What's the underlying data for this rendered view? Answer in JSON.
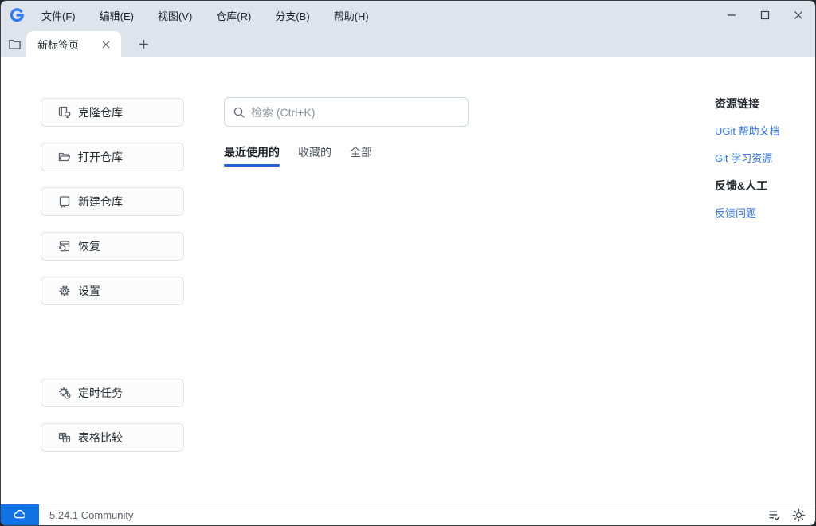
{
  "window": {
    "menu": [
      "文件(F)",
      "编辑(E)",
      "视图(V)",
      "仓库(R)",
      "分支(B)",
      "帮助(H)"
    ]
  },
  "tabbar": {
    "tab_label": "新标签页"
  },
  "sidebar": {
    "buttons": [
      {
        "label": "克隆仓库",
        "icon": "repo-clone-icon"
      },
      {
        "label": "打开仓库",
        "icon": "folder-open-icon"
      },
      {
        "label": "新建仓库",
        "icon": "repo-new-icon"
      },
      {
        "label": "恢复",
        "icon": "restore-icon"
      },
      {
        "label": "设置",
        "icon": "gear-icon"
      }
    ],
    "tools": [
      {
        "label": "定时任务",
        "icon": "scheduled-task-icon"
      },
      {
        "label": "表格比较",
        "icon": "table-compare-icon"
      }
    ]
  },
  "main": {
    "search_placeholder": "检索 (Ctrl+K)",
    "tabs": [
      {
        "label": "最近使用的",
        "active": true
      },
      {
        "label": "收藏的",
        "active": false
      },
      {
        "label": "全部",
        "active": false
      }
    ]
  },
  "links_panel": {
    "sections": [
      {
        "title": "资源链接",
        "links": [
          "UGit 帮助文档",
          "Git 学习资源"
        ]
      },
      {
        "title": "反馈&人工",
        "links": [
          "反馈问题"
        ]
      }
    ]
  },
  "statusbar": {
    "version": "5.24.1 Community"
  },
  "colors": {
    "chrome_bg": "#dfe3eb",
    "accent_blue": "#1273e6",
    "link_blue": "#2e72e4",
    "tab_underline": "#2563d9",
    "logo_blue": "#2e7cf6"
  }
}
